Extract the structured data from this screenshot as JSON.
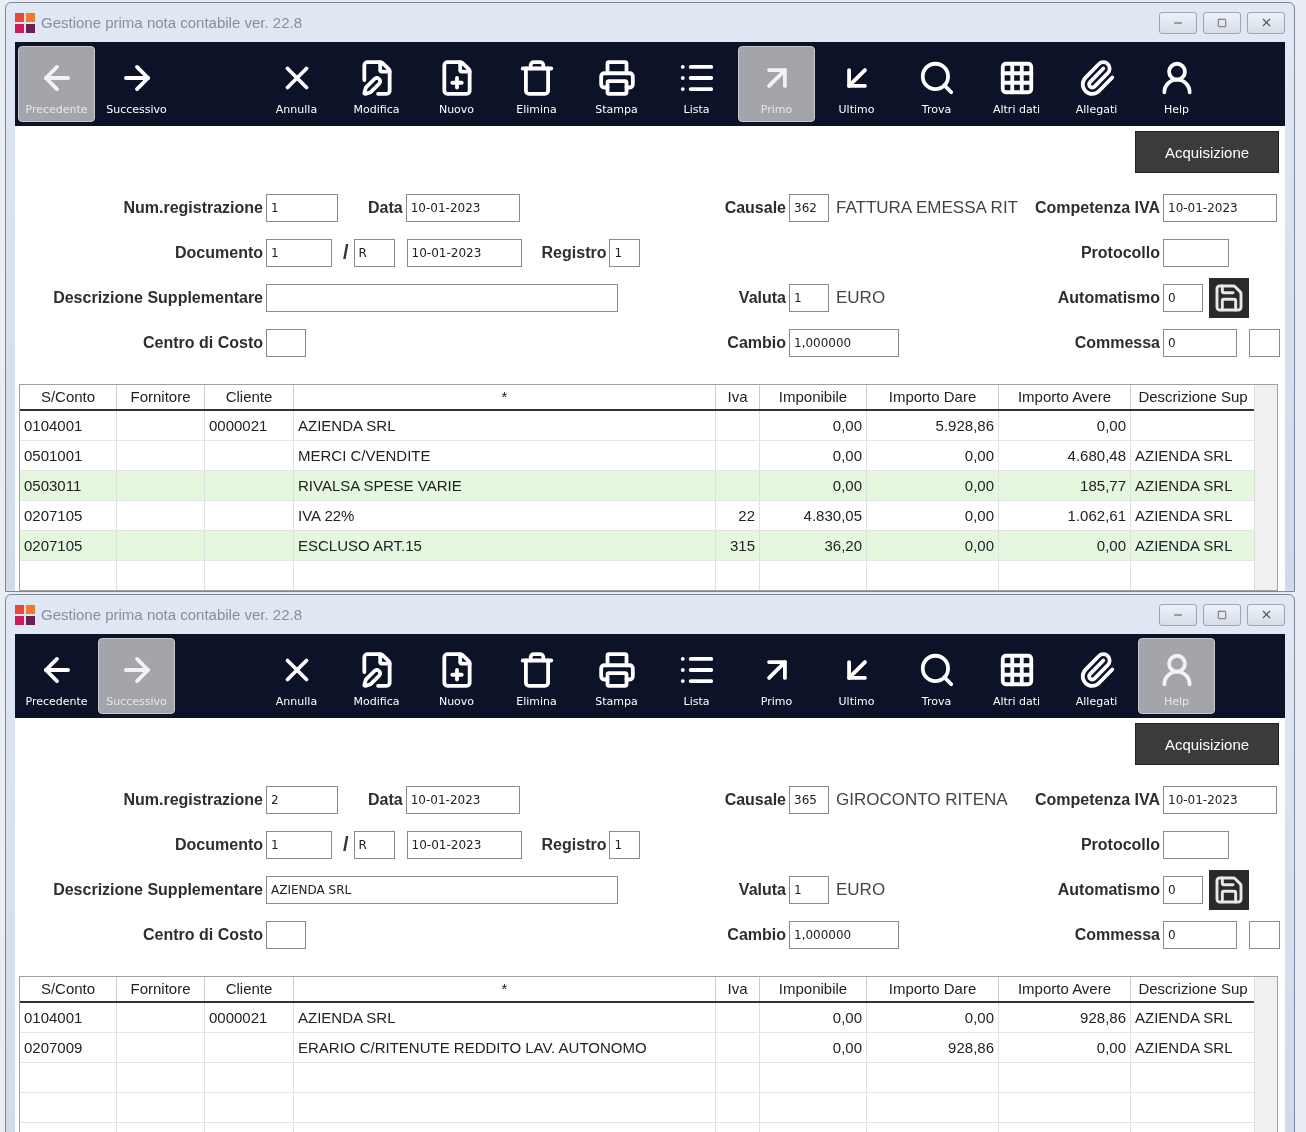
{
  "windows": [
    {
      "title": "Gestione prima nota contabile ver. 22.8",
      "toolbar": [
        {
          "label": "Precedente",
          "selected": true
        },
        {
          "label": "Successivo",
          "selected": false
        },
        {
          "label": "Annulla",
          "selected": false
        },
        {
          "label": "Modifica",
          "selected": false
        },
        {
          "label": "Nuovo",
          "selected": false
        },
        {
          "label": "Elimina",
          "selected": false
        },
        {
          "label": "Stampa",
          "selected": false
        },
        {
          "label": "Lista",
          "selected": false
        },
        {
          "label": "Primo",
          "selected": true
        },
        {
          "label": "Ultimo",
          "selected": false
        },
        {
          "label": "Trova",
          "selected": false
        },
        {
          "label": "Altri dati",
          "selected": false
        },
        {
          "label": "Allegati",
          "selected": false
        },
        {
          "label": "Help",
          "selected": false
        }
      ],
      "action_button": "Acquisizione",
      "form": {
        "num_registrazione": {
          "label": "Num.registrazione",
          "value": "1"
        },
        "data": {
          "label": "Data",
          "value": "10-01-2023"
        },
        "documento": {
          "label": "Documento",
          "number": "1",
          "separator": "/",
          "series": "R",
          "date": "10-01-2023"
        },
        "registro": {
          "label": "Registro",
          "value": "1"
        },
        "descrizione_supplementare": {
          "label": "Descrizione Supplementare"
        },
        "centro_di_costo": {
          "label": "Centro di Costo"
        },
        "causale": {
          "label": "Causale",
          "code": "362",
          "description": "FATTURA EMESSA RIT"
        },
        "competenza_iva": {
          "label": "Competenza IVA",
          "value": "10-01-2023"
        },
        "protocollo": {
          "label": "Protocollo"
        },
        "valuta": {
          "label": "Valuta",
          "code": "1",
          "description": "EURO"
        },
        "cambio": {
          "label": "Cambio",
          "value": "1,000000"
        },
        "automatismo": {
          "label": "Automatismo",
          "value": "0"
        },
        "commessa": {
          "label": "Commessa",
          "value": "0"
        }
      },
      "table": {
        "columns": [
          "S/Conto",
          "Fornitore",
          "Cliente",
          "*",
          "Iva",
          "Imponibile",
          "Importo Dare",
          "Importo Avere",
          "Descrizione Sup"
        ],
        "rows": [
          {
            "cells": [
              "0104001",
              null,
              "0000021",
              "AZIENDA SRL",
              null,
              "0,00",
              "5.928,86",
              "0,00",
              null
            ],
            "highlighted": false
          },
          {
            "cells": [
              "0501001",
              null,
              null,
              "MERCI C/VENDITE",
              null,
              "0,00",
              "0,00",
              "4.680,48",
              "AZIENDA SRL"
            ],
            "highlighted": false
          },
          {
            "cells": [
              "0503011",
              null,
              null,
              "RIVALSA SPESE VARIE",
              null,
              "0,00",
              "0,00",
              "185,77",
              "AZIENDA SRL"
            ],
            "highlighted": true
          },
          {
            "cells": [
              "0207105",
              null,
              null,
              "IVA 22%",
              "22",
              "4.830,05",
              "0,00",
              "1.062,61",
              "AZIENDA SRL"
            ],
            "highlighted": false
          },
          {
            "cells": [
              "0207105",
              null,
              null,
              "ESCLUSO ART.15",
              "315",
              "36,20",
              "0,00",
              "0,00",
              "AZIENDA SRL"
            ],
            "highlighted": true
          }
        ]
      }
    },
    {
      "title": "Gestione prima nota contabile ver. 22.8",
      "toolbar": [
        {
          "label": "Precedente",
          "selected": false
        },
        {
          "label": "Successivo",
          "selected": true
        },
        {
          "label": "Annulla",
          "selected": false
        },
        {
          "label": "Modifica",
          "selected": false
        },
        {
          "label": "Nuovo",
          "selected": false
        },
        {
          "label": "Elimina",
          "selected": false
        },
        {
          "label": "Stampa",
          "selected": false
        },
        {
          "label": "Lista",
          "selected": false
        },
        {
          "label": "Primo",
          "selected": false
        },
        {
          "label": "Ultimo",
          "selected": false
        },
        {
          "label": "Trova",
          "selected": false
        },
        {
          "label": "Altri dati",
          "selected": false
        },
        {
          "label": "Allegati",
          "selected": false
        },
        {
          "label": "Help",
          "selected": true
        }
      ],
      "action_button": "Acquisizione",
      "form": {
        "num_registrazione": {
          "label": "Num.registrazione",
          "value": "2"
        },
        "data": {
          "label": "Data",
          "value": "10-01-2023"
        },
        "documento": {
          "label": "Documento",
          "number": "1",
          "separator": "/",
          "series": "R",
          "date": "10-01-2023"
        },
        "registro": {
          "label": "Registro",
          "value": "1"
        },
        "descrizione_supplementare": {
          "label": "Descrizione Supplementare",
          "value": "AZIENDA SRL"
        },
        "centro_di_costo": {
          "label": "Centro di Costo"
        },
        "causale": {
          "label": "Causale",
          "code": "365",
          "description": "GIROCONTO RITENA"
        },
        "competenza_iva": {
          "label": "Competenza IVA",
          "value": "10-01-2023"
        },
        "protocollo": {
          "label": "Protocollo"
        },
        "valuta": {
          "label": "Valuta",
          "code": "1",
          "description": "EURO"
        },
        "cambio": {
          "label": "Cambio",
          "value": "1,000000"
        },
        "automatismo": {
          "label": "Automatismo",
          "value": "0"
        },
        "commessa": {
          "label": "Commessa",
          "value": "0"
        }
      },
      "table": {
        "columns": [
          "S/Conto",
          "Fornitore",
          "Cliente",
          "*",
          "Iva",
          "Imponibile",
          "Importo Dare",
          "Importo Avere",
          "Descrizione Sup"
        ],
        "rows": [
          {
            "cells": [
              "0104001",
              null,
              "0000021",
              "AZIENDA SRL",
              null,
              "0,00",
              "0,00",
              "928,86",
              "AZIENDA SRL"
            ],
            "highlighted": false
          },
          {
            "cells": [
              "0207009",
              null,
              null,
              "ERARIO C/RITENUTE REDDITO LAV. AUTONOMO",
              null,
              "0,00",
              "928,86",
              "0,00",
              "AZIENDA SRL"
            ],
            "highlighted": false
          }
        ]
      }
    }
  ]
}
